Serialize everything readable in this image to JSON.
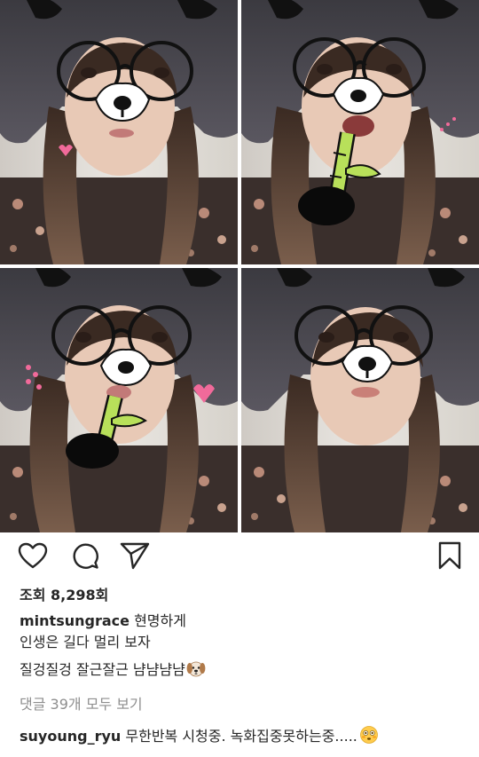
{
  "post": {
    "views_label": "조회 8,298회",
    "caption": {
      "username": "mintsungrace",
      "line1": "현명하게",
      "line2": "인생은 길다 멀리 보자",
      "line3": "질겅질겅 잘근잘근 냠냠냠냠",
      "emoji": "dog-face-emoji"
    },
    "view_all_comments": "댓글 39개 모두 보기",
    "top_comment": {
      "username": "suyoung_ryu",
      "text": "무한반복 시청중. 녹화집중못하는중.....",
      "emoji": "flushed-face-emoji"
    }
  },
  "actions": {
    "like_icon": "heart-icon",
    "comment_icon": "comment-bubble-icon",
    "share_icon": "paper-plane-icon",
    "save_icon": "bookmark-icon"
  },
  "photos": [
    {
      "filter": "panda-glasses-filter",
      "variant": "neutral-face"
    },
    {
      "filter": "panda-glasses-filter",
      "variant": "eating-bamboo"
    },
    {
      "filter": "panda-glasses-filter",
      "variant": "chewing-bamboo"
    },
    {
      "filter": "panda-glasses-filter",
      "variant": "pout-face"
    }
  ],
  "colors": {
    "text": "#262626",
    "muted": "#8e8e8e",
    "background": "#ffffff"
  }
}
